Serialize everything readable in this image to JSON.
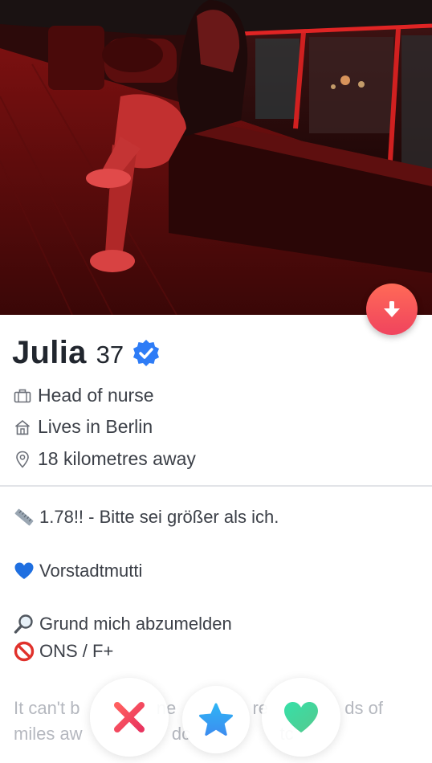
{
  "profile": {
    "name": "Julia",
    "age": "37",
    "job": "Head of nurse",
    "residence": "Lives in Berlin",
    "distance": "18 kilometres away"
  },
  "bio": {
    "height": "1.78!! - Bitte sei größer als ich.",
    "heart_line": "Vorstadtmutti",
    "search_line": "Grund mich abzumelden",
    "prohibited_line": "ONS / F+",
    "faded_line1_parts": [
      "It can't b",
      "ne",
      "re",
      "ds of"
    ],
    "faded_line2_parts": [
      "miles aw",
      "dc",
      "tc",
      ""
    ]
  },
  "icons": {
    "collapse": "arrow-down-icon",
    "verified": "verified-badge-icon",
    "job": "briefcase-icon",
    "residence": "house-icon",
    "distance": "location-pin-icon",
    "height": "ruler-icon",
    "heart": "blue-heart-icon",
    "search": "magnifier-icon",
    "prohibited": "prohibited-icon",
    "nope": "x-icon",
    "super_like": "star-icon",
    "like": "heart-icon"
  },
  "colors": {
    "accent_gradient_start": "#ff6a57",
    "accent_gradient_end": "#f0445e",
    "verified_blue": "#2e7cf6",
    "nope_red": "#f04d5f",
    "super_like_blue": "#3ca5f2",
    "like_green": "#3fdd9c",
    "text_dark": "#21262e",
    "text_body": "#3c4048"
  }
}
